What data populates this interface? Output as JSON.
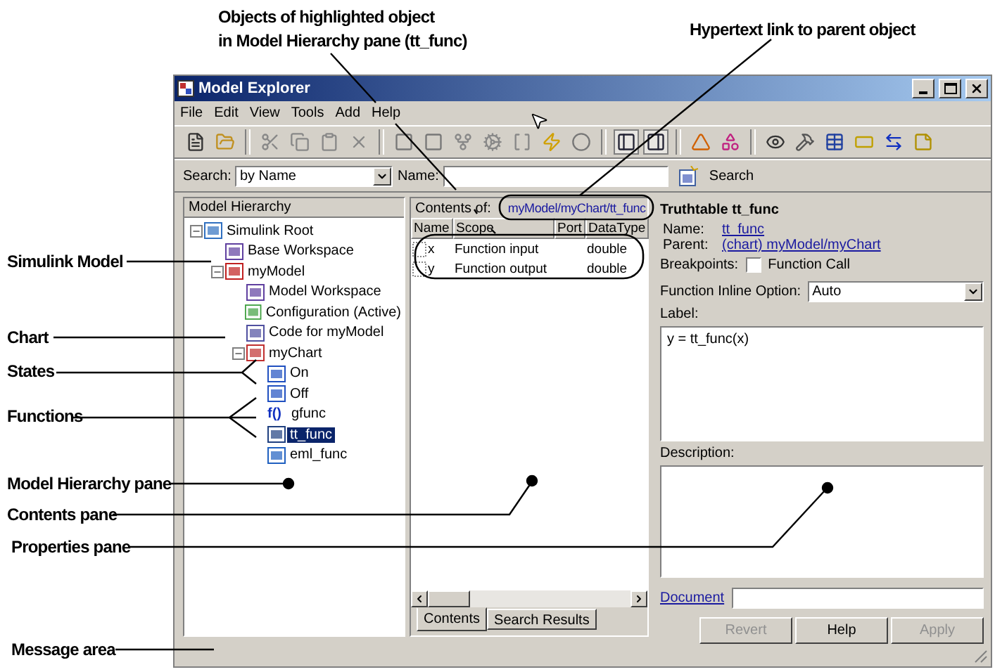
{
  "annotations": {
    "top": [
      {
        "text": "Objects of highlighted object"
      },
      {
        "text": "in Model Hierarchy pane (tt_func)"
      },
      {
        "text": "Hypertext link to parent object"
      }
    ],
    "side": [
      {
        "text": "Simulink Model"
      },
      {
        "text": "Chart"
      },
      {
        "text": "States"
      },
      {
        "text": "Functions"
      },
      {
        "text": "Model Hierarchy pane"
      },
      {
        "text": "Contents pane"
      },
      {
        "text": "Properties pane"
      },
      {
        "text": "Message area"
      }
    ]
  },
  "window": {
    "title": "Model Explorer"
  },
  "menu": [
    "File",
    "Edit",
    "View",
    "Tools",
    "Add",
    "Help"
  ],
  "search_bar": {
    "search_label": "Search:",
    "search_by": "by Name",
    "name_label": "Name:",
    "button": "Search"
  },
  "hierarchy": {
    "title": "Model Hierarchy",
    "tree": [
      {
        "label": "Simulink Root",
        "kind": "root",
        "expanded": true,
        "selected": false,
        "children": [
          {
            "label": "Base Workspace",
            "kind": "workspace",
            "selected": false
          },
          {
            "label": "myModel",
            "kind": "model",
            "expanded": true,
            "selected": false,
            "children": [
              {
                "label": "Model Workspace",
                "kind": "workspace",
                "selected": false
              },
              {
                "label": "Configuration (Active)",
                "kind": "config",
                "selected": false
              },
              {
                "label": "Code for myModel",
                "kind": "code",
                "selected": false
              },
              {
                "label": "myChart",
                "kind": "chart",
                "expanded": true,
                "selected": false,
                "children": [
                  {
                    "label": "On",
                    "kind": "state",
                    "selected": false
                  },
                  {
                    "label": "Off",
                    "kind": "state",
                    "selected": false
                  },
                  {
                    "label": "gfunc",
                    "kind": "function",
                    "glyph": "f()",
                    "selected": false
                  },
                  {
                    "label": "tt_func",
                    "kind": "truthtable",
                    "selected": true
                  },
                  {
                    "label": "eml_func",
                    "kind": "eml",
                    "selected": false
                  }
                ]
              }
            ]
          }
        ]
      }
    ]
  },
  "contents": {
    "label": "Contents of:",
    "path": "myModel/myChart/tt_func",
    "columns": [
      "Name",
      "Scope",
      "Port",
      "DataType"
    ],
    "rows": [
      {
        "name": "x",
        "scope": "Function input",
        "port": "",
        "datatype": "double"
      },
      {
        "name": "y",
        "scope": "Function output",
        "port": "",
        "datatype": "double"
      }
    ],
    "tabs": [
      {
        "label": "Contents",
        "selected": true
      },
      {
        "label": "Search Results",
        "selected": false
      }
    ]
  },
  "properties": {
    "title": "Truthtable tt_func",
    "name_label": "Name:",
    "name": "tt_func",
    "parent_label": "Parent:",
    "parent": "(chart) myModel/myChart",
    "breakpoints_label": "Breakpoints:",
    "breakpoint": {
      "label": "Function Call",
      "checked": false
    },
    "inline_label": "Function Inline Option:",
    "inline_value": "Auto",
    "label_label": "Label:",
    "label_value": "y = tt_func(x)",
    "description_label": "Description:",
    "document_label": "Document",
    "buttons": [
      {
        "label": "Revert",
        "disabled": true
      },
      {
        "label": "Help",
        "disabled": false
      },
      {
        "label": "Apply",
        "disabled": true
      }
    ]
  }
}
